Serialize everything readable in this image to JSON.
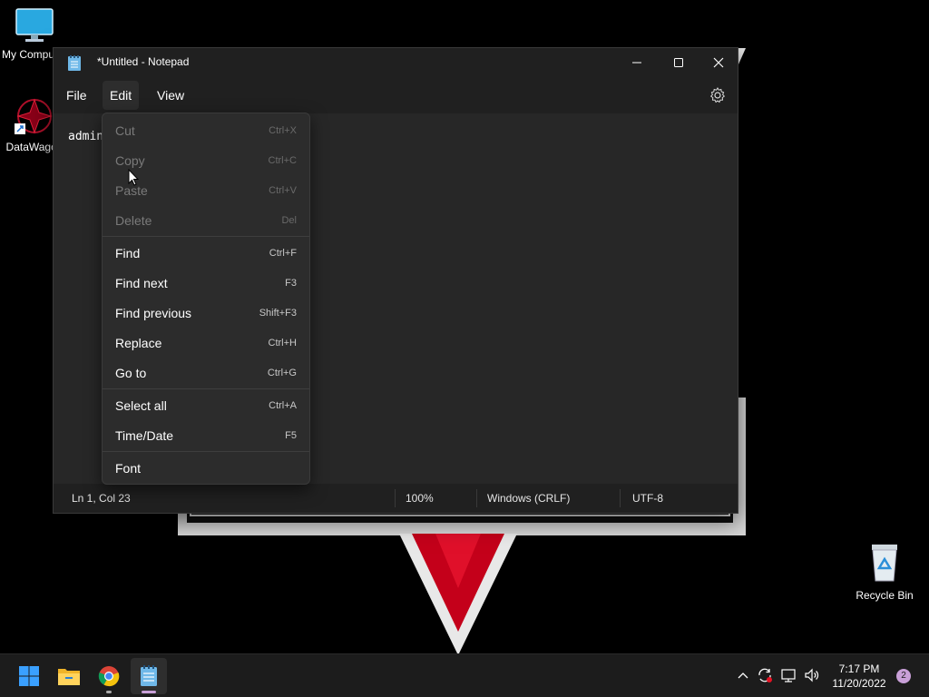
{
  "desktop": {
    "icons": [
      {
        "label": "My Computer",
        "icon": "monitor-icon"
      },
      {
        "label": "DataWagon",
        "icon": "datawagon-icon"
      }
    ],
    "recycle_bin": {
      "label": "Recycle Bin",
      "icon": "recycle-bin-icon"
    }
  },
  "window": {
    "title": "*Untitled - Notepad",
    "app_icon": "notepad-icon",
    "menu": {
      "file": "File",
      "edit": "Edit",
      "view": "View"
    },
    "editor_text": "admin",
    "status": {
      "position": "Ln 1, Col 23",
      "zoom": "100%",
      "line_ending": "Windows (CRLF)",
      "encoding": "UTF-8"
    }
  },
  "edit_menu": {
    "items": [
      {
        "label": "Cut",
        "shortcut": "Ctrl+X",
        "enabled": false
      },
      {
        "label": "Copy",
        "shortcut": "Ctrl+C",
        "enabled": false
      },
      {
        "label": "Paste",
        "shortcut": "Ctrl+V",
        "enabled": false
      },
      {
        "label": "Delete",
        "shortcut": "Del",
        "enabled": false
      },
      {
        "label": "Find",
        "shortcut": "Ctrl+F",
        "enabled": true
      },
      {
        "label": "Find next",
        "shortcut": "F3",
        "enabled": true
      },
      {
        "label": "Find previous",
        "shortcut": "Shift+F3",
        "enabled": true
      },
      {
        "label": "Replace",
        "shortcut": "Ctrl+H",
        "enabled": true
      },
      {
        "label": "Go to",
        "shortcut": "Ctrl+G",
        "enabled": true
      },
      {
        "label": "Select all",
        "shortcut": "Ctrl+A",
        "enabled": true
      },
      {
        "label": "Time/Date",
        "shortcut": "F5",
        "enabled": true
      },
      {
        "label": "Font",
        "shortcut": "",
        "enabled": true
      }
    ]
  },
  "taskbar": {
    "apps": [
      "start-icon",
      "file-explorer-icon",
      "chrome-icon",
      "notepad-icon"
    ],
    "clock": {
      "time": "7:17 PM",
      "date": "11/20/2022"
    },
    "notification_count": "2"
  },
  "colors": {
    "accent": "#c9a0d8",
    "wallpaper_red": "#d0021b"
  }
}
